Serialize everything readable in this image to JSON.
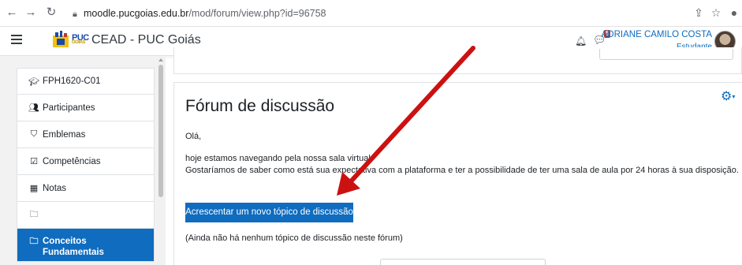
{
  "browser": {
    "url_host": "moodle.pucgoias.edu.br",
    "url_path": "/mod/forum/view.php?id=96758",
    "icons": [
      "back-icon",
      "forward-icon",
      "reload-icon",
      "lock-icon",
      "share-icon",
      "star-icon",
      "profile-icon"
    ]
  },
  "navbar": {
    "logo_text": "PUC",
    "logo_subtext": "GOIÁS",
    "site_name": "CEAD - PUC Goiás",
    "notification_count": "5",
    "user_name": "ADRIANE CAMILO COSTA",
    "user_role": "Estudante"
  },
  "drawer": {
    "items": [
      {
        "label": "FPH1620-C01",
        "icon": "graduation-cap-icon"
      },
      {
        "label": "Participantes",
        "icon": "users-icon"
      },
      {
        "label": "Emblemas",
        "icon": "shield-icon"
      },
      {
        "label": "Competências",
        "icon": "checkbox-icon"
      },
      {
        "label": "Notas",
        "icon": "table-icon"
      },
      {
        "label": "",
        "icon": "folder-icon"
      },
      {
        "label": "Conceitos Fundamentais",
        "icon": "folder-icon"
      }
    ]
  },
  "main": {
    "title": "Fórum de discussão",
    "greeting": "Olá,",
    "line1": "hoje estamos navegando pela nossa sala virtual.",
    "line2": "Gostaríamos de saber como está sua expectativa com a plataforma e ter a possibilidade de ter uma sala de aula por 24 horas à sua disposição.",
    "add_button": "Acrescentar um novo tópico de discussão",
    "empty_notice": "(Ainda não há nenhum tópico de discussão neste fórum)"
  },
  "colors": {
    "brand_blue": "#0f6cbf",
    "annotation_red": "#cc1111",
    "badge_red": "#ca3120"
  }
}
